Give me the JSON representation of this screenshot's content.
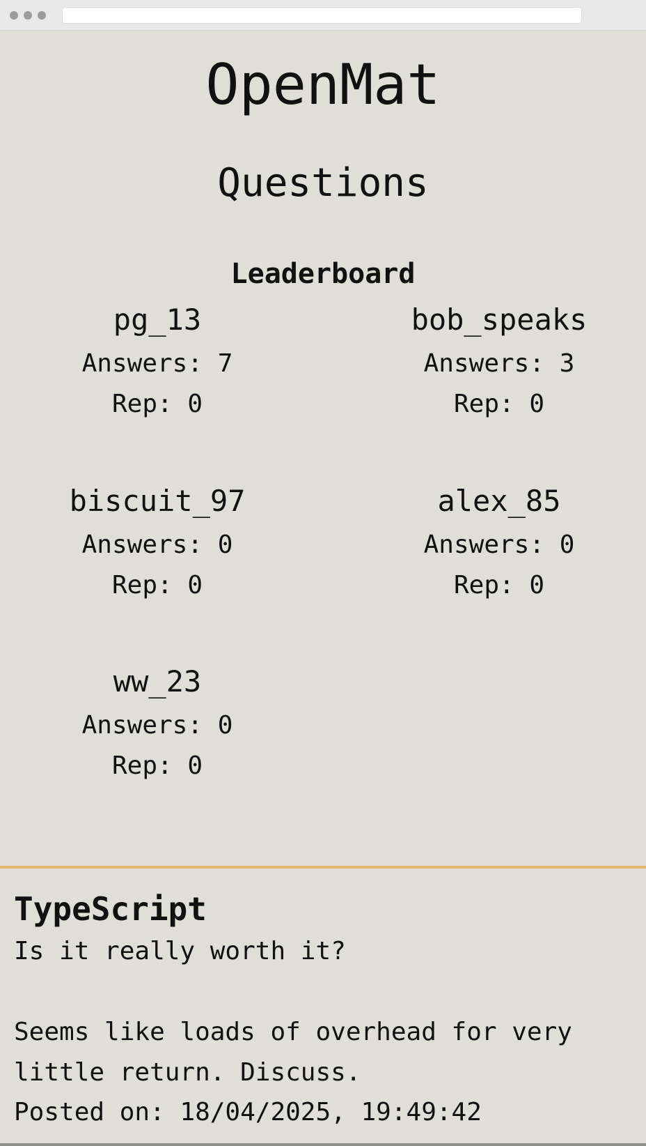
{
  "app": {
    "title": "OpenMat"
  },
  "page": {
    "heading": "Questions"
  },
  "leaderboard": {
    "title": "Leaderboard",
    "answers_label": "Answers:",
    "rep_label": "Rep:",
    "users": [
      {
        "username": "pg_13",
        "answers": "Answers: 7",
        "rep": "Rep: 0"
      },
      {
        "username": "bob_speaks",
        "answers": "Answers: 3",
        "rep": "Rep: 0"
      },
      {
        "username": "biscuit_97",
        "answers": "Answers: 0",
        "rep": "Rep: 0"
      },
      {
        "username": "alex_85",
        "answers": "Answers: 0",
        "rep": "Rep: 0"
      },
      {
        "username": "ww_23",
        "answers": "Answers: 0",
        "rep": "Rep: 0"
      }
    ]
  },
  "question": {
    "title": "TypeScript",
    "body": "Is it really worth it?\n\nSeems like loads of overhead for very little return. Discuss.",
    "posted": "Posted on: 18/04/2025, 19:49:42"
  },
  "colors": {
    "background": "#dfdfd7",
    "divider": "#dfb76a",
    "text": "#111111"
  }
}
